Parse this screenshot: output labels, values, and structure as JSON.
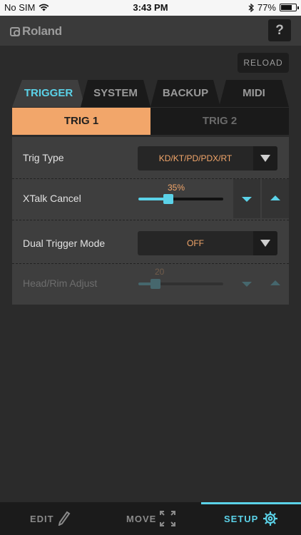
{
  "status": {
    "carrier": "No SIM",
    "time": "3:43 PM",
    "battery": "77%",
    "battery_level": 0.77
  },
  "header": {
    "brand": "Roland",
    "help_label": "?"
  },
  "reload_label": "RELOAD",
  "tabs": [
    {
      "label": "TRIGGER",
      "active": true
    },
    {
      "label": "SYSTEM",
      "active": false
    },
    {
      "label": "BACKUP",
      "active": false
    },
    {
      "label": "MIDI",
      "active": false
    }
  ],
  "subtabs": [
    {
      "label": "TRIG 1",
      "active": true
    },
    {
      "label": "TRIG 2",
      "active": false
    }
  ],
  "params": {
    "trig_type": {
      "label": "Trig Type",
      "value": "KD/KT/PD/PDX/RT"
    },
    "xtalk_cancel": {
      "label": "XTalk Cancel",
      "value": "35%",
      "level": 0.35
    },
    "dual_trigger_mode": {
      "label": "Dual Trigger Mode",
      "value": "OFF"
    },
    "head_rim_adjust": {
      "label": "Head/Rim Adjust",
      "value": "20",
      "level": 0.2,
      "enabled": false
    }
  },
  "nav": [
    {
      "label": "EDIT",
      "icon": "pencil-icon",
      "active": false
    },
    {
      "label": "MOVE",
      "icon": "expand-arrows-icon",
      "active": false
    },
    {
      "label": "SETUP",
      "icon": "gear-icon",
      "active": true
    }
  ],
  "colors": {
    "accent": "#5bd2e8",
    "highlight": "#f2a66a"
  }
}
